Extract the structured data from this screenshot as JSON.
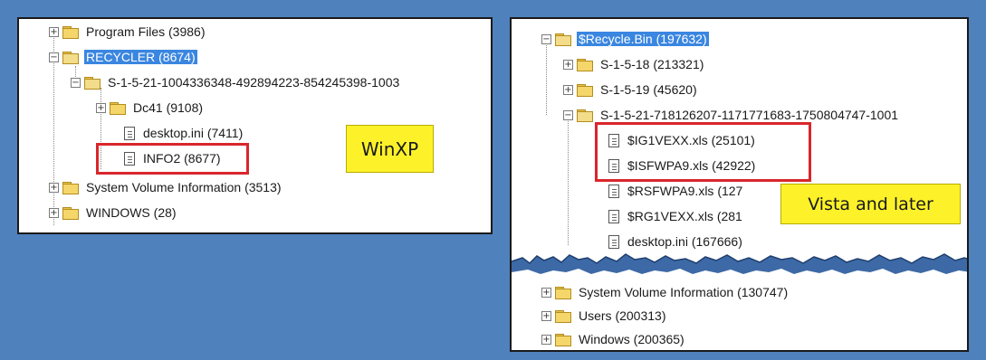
{
  "left_panel": {
    "nodes": [
      {
        "label": "Program Files (3986)",
        "expander": "+"
      },
      {
        "label": "RECYCLER (8674)",
        "expander": "−"
      },
      {
        "label": "S-1-5-21-1004336348-492894223-854245398-1003",
        "expander": "−"
      },
      {
        "label": "Dc41 (9108)",
        "expander": "+"
      },
      {
        "label": "desktop.ini (7411)"
      },
      {
        "label": "INFO2 (8677)"
      },
      {
        "label": "System Volume Information (3513)",
        "expander": "+"
      },
      {
        "label": "WINDOWS (28)",
        "expander": "+"
      }
    ],
    "callout": "WinXP"
  },
  "right_panel": {
    "nodes": [
      {
        "label": "$Recycle.Bin (197632)",
        "expander": "−"
      },
      {
        "label": "S-1-5-18 (213321)",
        "expander": "+"
      },
      {
        "label": "S-1-5-19 (45620)",
        "expander": "+"
      },
      {
        "label": "S-1-5-21-718126207-1171771683-1750804747-1001",
        "expander": "−"
      },
      {
        "label": "$IG1VEXX.xls (25101)"
      },
      {
        "label": "$ISFWPA9.xls (42922)"
      },
      {
        "label": "$RSFWPA9.xls (127"
      },
      {
        "label": "$RG1VEXX.xls (281"
      },
      {
        "label": "desktop.ini (167666)"
      },
      {
        "label": "System Volume Information (130747)",
        "expander": "+"
      },
      {
        "label": "Users (200313)",
        "expander": "+"
      },
      {
        "label": "Windows (200365)",
        "expander": "+"
      }
    ],
    "callout": "Vista and later"
  },
  "colors": {
    "background": "#4f81bd",
    "selection": "#3a86e0",
    "highlight_box": "#d9262b",
    "callout": "#fdf229"
  }
}
